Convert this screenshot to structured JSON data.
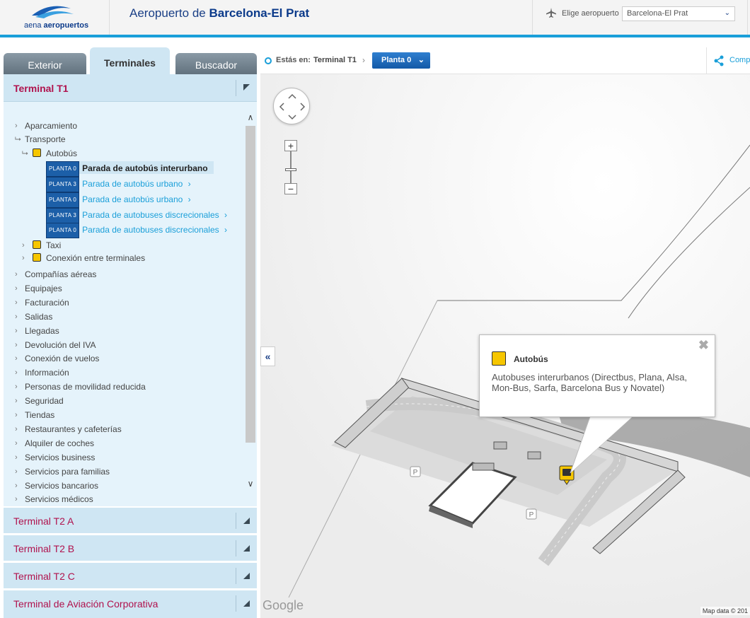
{
  "header": {
    "logo_brand_light": "aena",
    "logo_brand_bold": "aeropuertos",
    "title_prefix": "Aeropuerto de",
    "title_airport": "Barcelona-El Prat",
    "airport_label": "Elige aeropuerto",
    "airport_selected": "Barcelona-El Prat"
  },
  "tabs": [
    {
      "label": "Exterior",
      "active": false
    },
    {
      "label": "Terminales",
      "active": true
    },
    {
      "label": "Buscador",
      "active": false
    }
  ],
  "terminal_t1": {
    "title": "Terminal T1",
    "tree": {
      "aparcamiento": "Aparcamiento",
      "transporte": "Transporte",
      "autobus": "Autobús",
      "bus_stops": [
        {
          "planta": "PLANTA 0",
          "label": "Parada de autobús interurbano",
          "selected": true
        },
        {
          "planta": "PLANTA 3",
          "label": "Parada de autobús urbano",
          "selected": false
        },
        {
          "planta": "PLANTA 0",
          "label": "Parada de autobús urbano",
          "selected": false
        },
        {
          "planta": "PLANTA 3",
          "label": "Parada de autobuses discrecionales",
          "selected": false
        },
        {
          "planta": "PLANTA 0",
          "label": "Parada de autobuses discrecionales",
          "selected": false
        }
      ],
      "taxi": "Taxi",
      "conexion_terminales": "Conexión entre terminales",
      "categories": [
        "Compañías aéreas",
        "Equipajes",
        "Facturación",
        "Salidas",
        "Llegadas",
        "Devolución del IVA",
        "Conexión de vuelos",
        "Información",
        "Personas de movilidad reducida",
        "Seguridad",
        "Tiendas",
        "Restaurantes y cafeterías",
        "Alquiler de coches",
        "Servicios business",
        "Servicios para familias",
        "Servicios bancarios",
        "Servicios médicos"
      ]
    }
  },
  "other_terminals": [
    "Terminal T2 A",
    "Terminal T2 B",
    "Terminal T2 C",
    "Terminal de Aviación Corporativa"
  ],
  "breadcrumb": {
    "label": "Estás en:",
    "terminal": "Terminal T1",
    "planta": "Planta 0",
    "share": "Comp"
  },
  "map": {
    "collapse": "«",
    "parking_label": "P",
    "google": "Google",
    "map_data": "Map data © 201"
  },
  "popup": {
    "title": "Autobús",
    "body": "Autobuses interurbanos (Directbus, Plana, Alsa, Mon-Bus, Sarfa, Barcelona Bus y Novatel)",
    "close": "✖"
  },
  "colors": {
    "accent_blue": "#1a9fd9",
    "brand_navy": "#0b3a8a",
    "terminal_red": "#b0124d",
    "panel_bg": "#e5f3fb",
    "bus_yellow": "#f6c600"
  }
}
